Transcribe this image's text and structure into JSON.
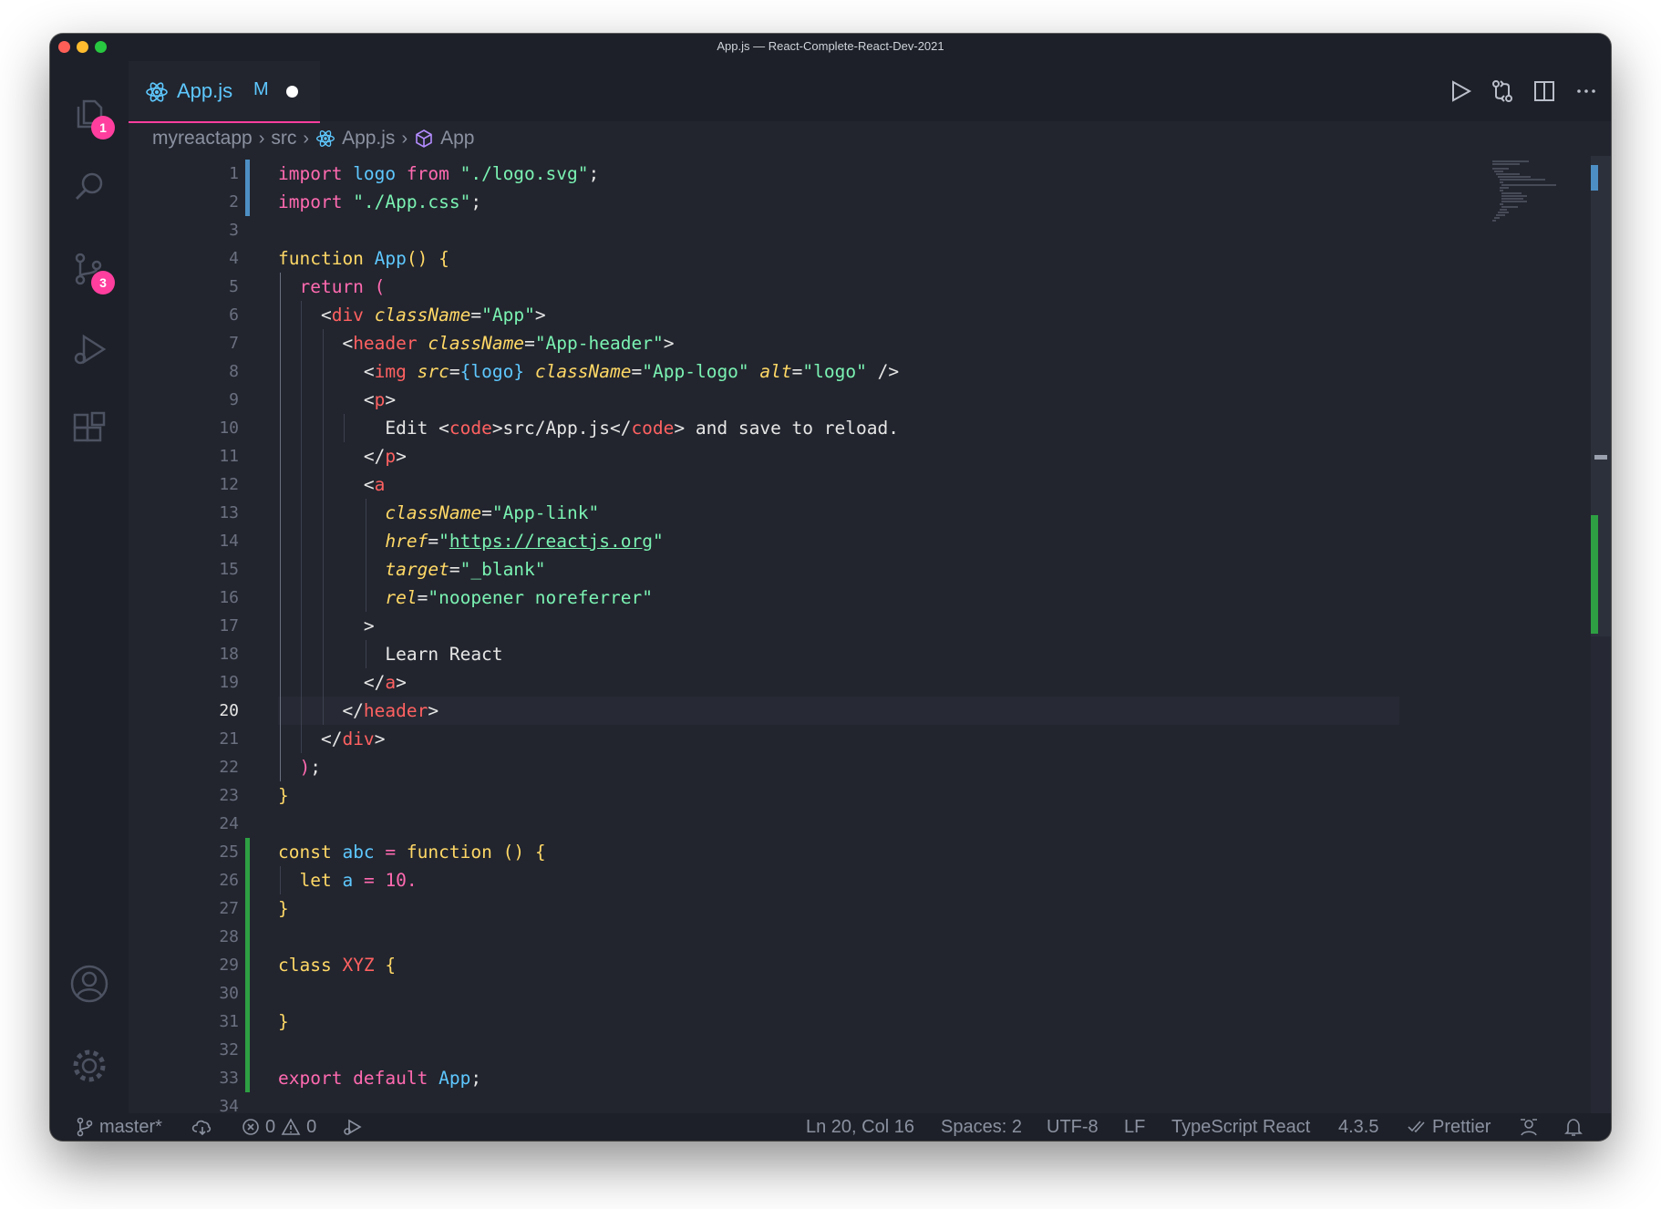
{
  "window": {
    "title": "App.js — React-Complete-React-Dev-2021"
  },
  "activity": {
    "explorer_badge": "1",
    "scm_badge": "3"
  },
  "tab": {
    "label": "App.js",
    "status": "M"
  },
  "breadcrumb": [
    "myreactapp",
    "src",
    "App.js",
    "App"
  ],
  "editor": {
    "active_line": "20",
    "line_numbers": [
      "1",
      "2",
      "3",
      "4",
      "5",
      "6",
      "7",
      "8",
      "9",
      "10",
      "11",
      "12",
      "13",
      "14",
      "15",
      "16",
      "17",
      "18",
      "19",
      "20",
      "21",
      "22",
      "23",
      "24",
      "25",
      "26",
      "27",
      "28",
      "29",
      "30",
      "31",
      "32",
      "33",
      "34"
    ],
    "lines": [
      [
        {
          "c": "kw",
          "t": "import "
        },
        {
          "c": "fn",
          "t": "logo"
        },
        {
          "c": "kw",
          "t": " from "
        },
        {
          "c": "str",
          "t": "\"./logo.svg\""
        },
        {
          "c": "pl",
          "t": ";"
        }
      ],
      [
        {
          "c": "kw",
          "t": "import "
        },
        {
          "c": "str",
          "t": "\"./App.css\""
        },
        {
          "c": "pl",
          "t": ";"
        }
      ],
      [],
      [
        {
          "c": "kw2",
          "t": "function "
        },
        {
          "c": "fn",
          "t": "App"
        },
        {
          "c": "br",
          "t": "() {"
        }
      ],
      [
        {
          "c": "kw",
          "t": "  return "
        },
        {
          "c": "kw",
          "t": "("
        }
      ],
      [
        {
          "c": "pl",
          "t": "    <"
        },
        {
          "c": "tag",
          "t": "div"
        },
        {
          "c": "pl",
          "t": " "
        },
        {
          "c": "attr",
          "t": "className"
        },
        {
          "c": "pl",
          "t": "="
        },
        {
          "c": "str",
          "t": "\"App\""
        },
        {
          "c": "pl",
          "t": ">"
        }
      ],
      [
        {
          "c": "pl",
          "t": "      <"
        },
        {
          "c": "tag",
          "t": "header"
        },
        {
          "c": "pl",
          "t": " "
        },
        {
          "c": "attr",
          "t": "className"
        },
        {
          "c": "pl",
          "t": "="
        },
        {
          "c": "str",
          "t": "\"App-header\""
        },
        {
          "c": "pl",
          "t": ">"
        }
      ],
      [
        {
          "c": "pl",
          "t": "        <"
        },
        {
          "c": "tag",
          "t": "img"
        },
        {
          "c": "pl",
          "t": " "
        },
        {
          "c": "attr",
          "t": "src"
        },
        {
          "c": "pl",
          "t": "="
        },
        {
          "c": "fn",
          "t": "{logo}"
        },
        {
          "c": "pl",
          "t": " "
        },
        {
          "c": "attr",
          "t": "className"
        },
        {
          "c": "pl",
          "t": "="
        },
        {
          "c": "str",
          "t": "\"App-logo\""
        },
        {
          "c": "pl",
          "t": " "
        },
        {
          "c": "attr",
          "t": "alt"
        },
        {
          "c": "pl",
          "t": "="
        },
        {
          "c": "str",
          "t": "\"logo\""
        },
        {
          "c": "pl",
          "t": " />"
        }
      ],
      [
        {
          "c": "pl",
          "t": "        <"
        },
        {
          "c": "tag",
          "t": "p"
        },
        {
          "c": "pl",
          "t": ">"
        }
      ],
      [
        {
          "c": "pl",
          "t": "          Edit <"
        },
        {
          "c": "tag",
          "t": "code"
        },
        {
          "c": "pl",
          "t": ">src/App.js</"
        },
        {
          "c": "tag",
          "t": "code"
        },
        {
          "c": "pl",
          "t": "> and save to reload."
        }
      ],
      [
        {
          "c": "pl",
          "t": "        </"
        },
        {
          "c": "tag",
          "t": "p"
        },
        {
          "c": "pl",
          "t": ">"
        }
      ],
      [
        {
          "c": "pl",
          "t": "        <"
        },
        {
          "c": "tag",
          "t": "a"
        }
      ],
      [
        {
          "c": "pl",
          "t": "          "
        },
        {
          "c": "attr",
          "t": "className"
        },
        {
          "c": "pl",
          "t": "="
        },
        {
          "c": "str",
          "t": "\"App-link\""
        }
      ],
      [
        {
          "c": "pl",
          "t": "          "
        },
        {
          "c": "attr",
          "t": "href"
        },
        {
          "c": "pl",
          "t": "="
        },
        {
          "c": "str",
          "t": "\""
        },
        {
          "c": "link",
          "t": "https://reactjs.org"
        },
        {
          "c": "str",
          "t": "\""
        }
      ],
      [
        {
          "c": "pl",
          "t": "          "
        },
        {
          "c": "attr",
          "t": "target"
        },
        {
          "c": "pl",
          "t": "="
        },
        {
          "c": "str",
          "t": "\"_blank\""
        }
      ],
      [
        {
          "c": "pl",
          "t": "          "
        },
        {
          "c": "attr",
          "t": "rel"
        },
        {
          "c": "pl",
          "t": "="
        },
        {
          "c": "str",
          "t": "\"noopener noreferrer\""
        }
      ],
      [
        {
          "c": "pl",
          "t": "        >"
        }
      ],
      [
        {
          "c": "pl",
          "t": "          Learn React"
        }
      ],
      [
        {
          "c": "pl",
          "t": "        </"
        },
        {
          "c": "tag",
          "t": "a"
        },
        {
          "c": "pl",
          "t": ">"
        }
      ],
      [
        {
          "c": "pl",
          "t": "      </"
        },
        {
          "c": "tag",
          "t": "header"
        },
        {
          "c": "pl",
          "t": ">"
        }
      ],
      [
        {
          "c": "pl",
          "t": "    </"
        },
        {
          "c": "tag",
          "t": "div"
        },
        {
          "c": "pl",
          "t": ">"
        }
      ],
      [
        {
          "c": "kw",
          "t": "  )"
        },
        {
          "c": "pl",
          "t": ";"
        }
      ],
      [
        {
          "c": "br",
          "t": "}"
        }
      ],
      [],
      [
        {
          "c": "kw2",
          "t": "const "
        },
        {
          "c": "fn",
          "t": "abc"
        },
        {
          "c": "kw",
          "t": " = "
        },
        {
          "c": "kw2",
          "t": "function "
        },
        {
          "c": "br",
          "t": "() {"
        }
      ],
      [
        {
          "c": "kw2",
          "t": "  let "
        },
        {
          "c": "fn",
          "t": "a"
        },
        {
          "c": "kw",
          "t": " = "
        },
        {
          "c": "num",
          "t": "10."
        }
      ],
      [
        {
          "c": "br",
          "t": "}"
        }
      ],
      [],
      [
        {
          "c": "kw2",
          "t": "class "
        },
        {
          "c": "cls",
          "t": "XYZ"
        },
        {
          "c": "br",
          "t": " {"
        }
      ],
      [],
      [
        {
          "c": "br",
          "t": "}"
        }
      ],
      [],
      [
        {
          "c": "kw",
          "t": "export default "
        },
        {
          "c": "fn",
          "t": "App"
        },
        {
          "c": "pl",
          "t": ";"
        }
      ],
      []
    ]
  },
  "status": {
    "branch": "master*",
    "errors": "0",
    "warnings": "0",
    "position": "Ln 20, Col 16",
    "spaces": "Spaces: 2",
    "encoding": "UTF-8",
    "eol": "LF",
    "language": "TypeScript React",
    "version": "4.3.5",
    "formatter": "Prettier"
  },
  "colors": {
    "accent": "#ff3e9e",
    "background": "#22252e",
    "diff_added": "#2ea043",
    "diff_modified": "#4d8fc4"
  },
  "icons": [
    "files-icon",
    "search-icon",
    "source-control-icon",
    "run-debug-icon",
    "extensions-icon",
    "account-icon",
    "settings-gear-icon",
    "run-icon",
    "compare-icon",
    "split-editor-icon",
    "more-icon",
    "react-icon",
    "cube-icon",
    "branch-icon",
    "sync-icon",
    "error-icon",
    "warning-icon",
    "debug-icon",
    "feedback-icon",
    "bell-icon"
  ]
}
